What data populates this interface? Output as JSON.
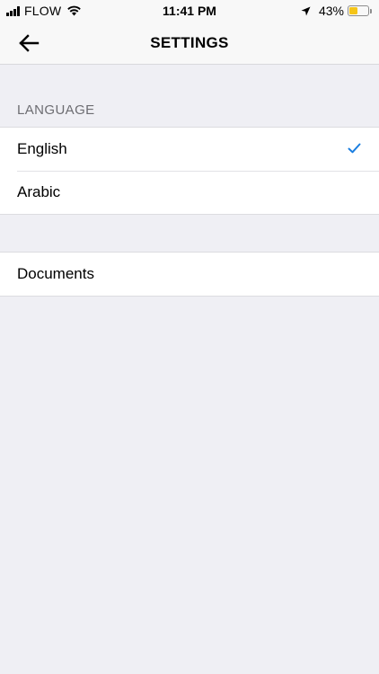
{
  "status_bar": {
    "carrier": "FLOW",
    "time": "11:41 PM",
    "battery_percent": "43%",
    "battery_level": 0.43,
    "battery_color": "#f5c518",
    "icons": [
      "signal-icon",
      "wifi-icon",
      "location-arrow-icon",
      "battery-icon"
    ]
  },
  "nav": {
    "title": "SETTINGS",
    "back_icon": "arrow-left-icon"
  },
  "language_section": {
    "header": "LANGUAGE",
    "options": [
      {
        "label": "English",
        "selected": true
      },
      {
        "label": "Arabic",
        "selected": false
      }
    ],
    "check_icon": "checkmark-icon",
    "accent_color": "#1a7ee0"
  },
  "documents_section": {
    "items": [
      {
        "label": "Documents"
      }
    ]
  }
}
